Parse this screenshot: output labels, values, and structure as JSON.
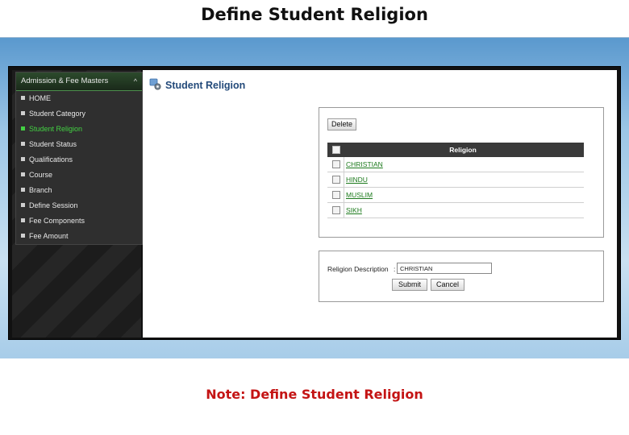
{
  "slide": {
    "title": "Define Student Religion",
    "note": "Note: Define Student Religion"
  },
  "sidebar": {
    "header": "Admission & Fee Masters",
    "caret": "^",
    "items": [
      {
        "label": "HOME",
        "active": false
      },
      {
        "label": "Student Category",
        "active": false
      },
      {
        "label": "Student Religion",
        "active": true
      },
      {
        "label": "Student Status",
        "active": false
      },
      {
        "label": "Qualifications",
        "active": false
      },
      {
        "label": "Course",
        "active": false
      },
      {
        "label": "Branch",
        "active": false
      },
      {
        "label": "Define Session",
        "active": false
      },
      {
        "label": "Fee Components",
        "active": false
      },
      {
        "label": "Fee Amount",
        "active": false
      }
    ]
  },
  "page": {
    "heading": "Student Religion",
    "icon": "gear-settings-icon"
  },
  "grid": {
    "delete_label": "Delete",
    "column_header": "Religion",
    "rows": [
      "CHRISTIAN",
      "HINDU",
      "MUSLIM",
      "SIKH"
    ]
  },
  "form": {
    "label": "Religion Description",
    "separator": ":",
    "value": "CHRISTIAN",
    "submit_label": "Submit",
    "cancel_label": "Cancel"
  },
  "colors": {
    "active_menu": "#43d143",
    "link": "#1d7a1d",
    "heading": "#234a7a",
    "note": "#c41414"
  }
}
